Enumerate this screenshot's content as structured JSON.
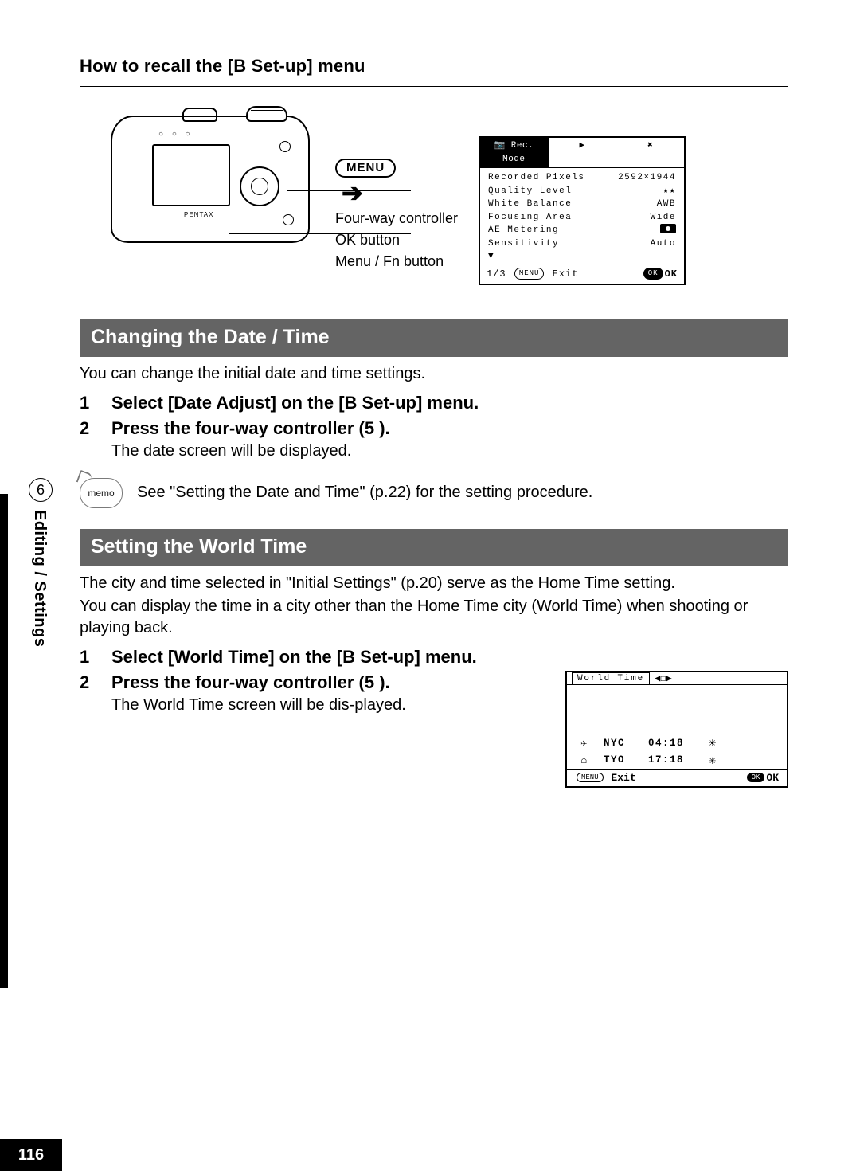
{
  "intro_title": "How to recall the [B  Set-up] menu",
  "diagram": {
    "menu_pill": "MENU",
    "label_fourway": "Four-way controller",
    "label_ok": "OK button",
    "label_menufn": "Menu / Fn button",
    "brand": "PENTAX"
  },
  "lcd1": {
    "tab_active": "Rec. Mode",
    "tab_camera_icon": "📷",
    "tab_play_icon": "▶",
    "tab_setup_icon": "✖",
    "rows": [
      {
        "label": "Recorded Pixels",
        "value": "2592×1944"
      },
      {
        "label": "Quality Level",
        "value": "★★"
      },
      {
        "label": "White Balance",
        "value": "AWB"
      },
      {
        "label": "Focusing Area",
        "value": "Wide"
      },
      {
        "label": "AE Metering",
        "value": "__metering_icon__"
      },
      {
        "label": "Sensitivity",
        "value": "Auto"
      }
    ],
    "footer_page": "1/3",
    "footer_menu_pill": "MENU",
    "footer_exit": "Exit",
    "footer_ok_pill": "OK",
    "footer_ok": "OK"
  },
  "section1_title": "Changing the Date / Time",
  "section1_intro": "You can change the initial date and time settings.",
  "step1a_num": "1",
  "step1a": "Select [Date Adjust] on the [B  Set-up] menu.",
  "step1b_num": "2",
  "step1b": "Press the four-way controller (5  ).",
  "step1b_sub": "The date screen will be displayed.",
  "memo_label": "memo",
  "memo_text": "See \"Setting the Date and Time\" (p.22) for the setting procedure.",
  "section2_title": "Setting the World Time",
  "section2_p1": "The city and time selected in \"Initial Settings\" (p.20) serve as the Home Time setting.",
  "section2_p2": "You can display the time in a city other than the Home Time city (World Time) when shooting or playing back.",
  "step2a_num": "1",
  "step2a": "Select [World Time] on the [B  Set-up] menu.",
  "step2b_num": "2",
  "step2b": "Press the four-way controller (5  ).",
  "step2b_sub": "The World Time screen will be dis-played.",
  "lcd2": {
    "tab": "World Time",
    "selector_icon": "◀ ▶",
    "city1_icon": "✈",
    "city1": "NYC",
    "time1": "04:18",
    "sun1": "☀",
    "city2_icon": "⌂",
    "city2": "TYO",
    "time2": "17:18",
    "sun2": "✳",
    "footer_menu_pill": "MENU",
    "footer_exit": "Exit",
    "footer_ok_pill": "OK",
    "footer_ok": "OK"
  },
  "sidebar": {
    "chapter_num": "6",
    "chapter_label": "Editing / Settings"
  },
  "page_number": "116"
}
